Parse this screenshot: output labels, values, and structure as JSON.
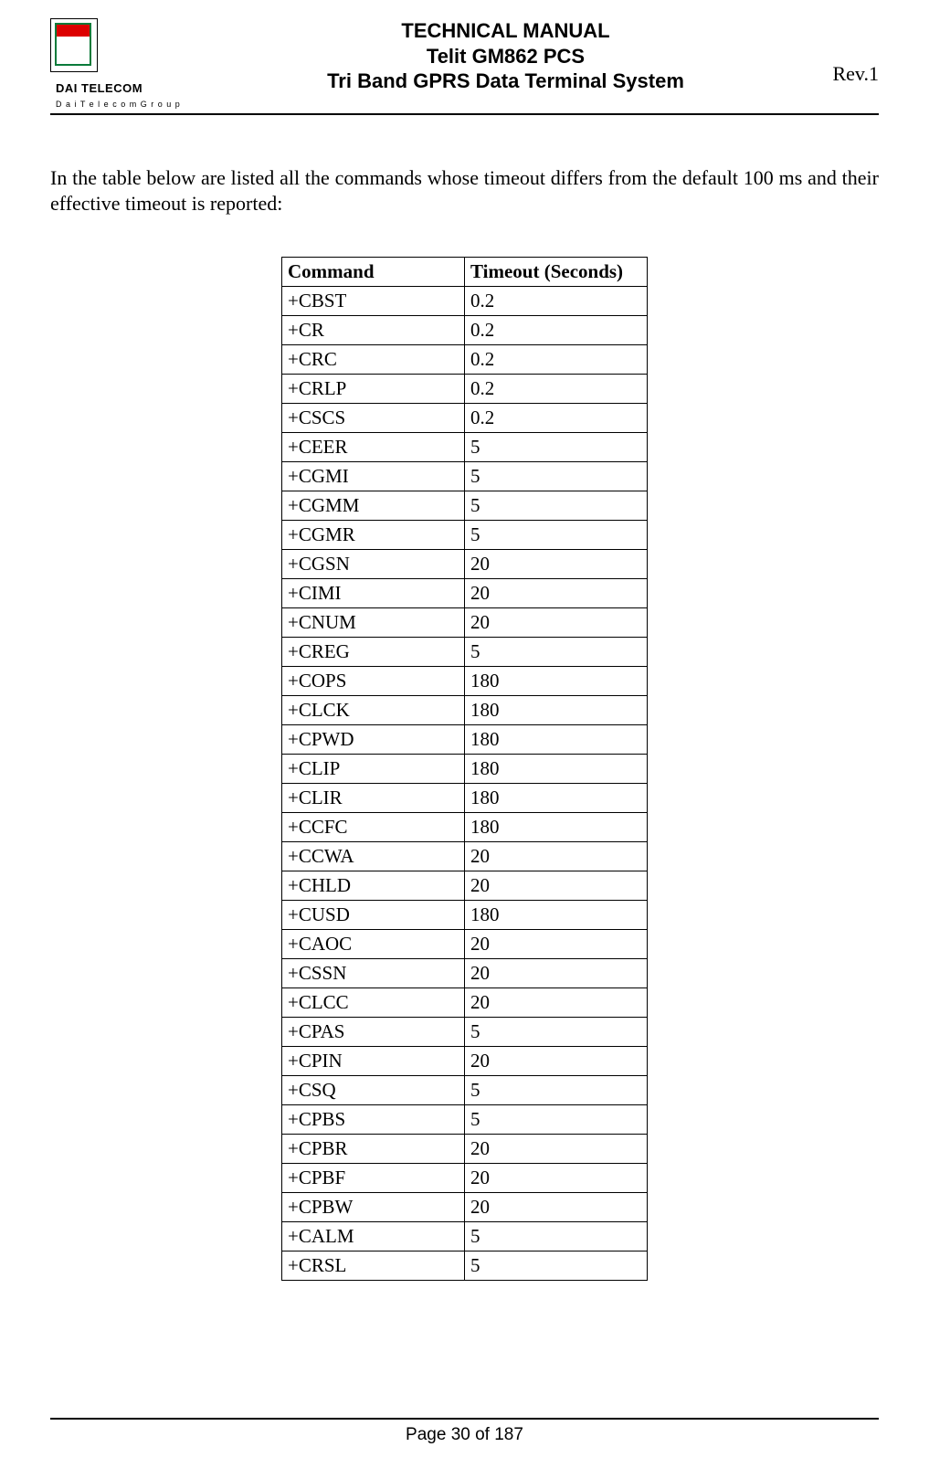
{
  "header": {
    "brand": "DAI TELECOM",
    "brand_sub": "D a i   T e l e c o m   G r o u p",
    "title_line1": "TECHNICAL MANUAL",
    "title_line2": "Telit GM862 PCS",
    "title_line3": "Tri Band GPRS Data Terminal System",
    "rev": "Rev.1"
  },
  "intro": "In the table below are listed all the commands whose timeout differs from the default 100 ms and their effective timeout is reported:",
  "table": {
    "head": {
      "col1": "Command",
      "col2": "Timeout  (Seconds)"
    },
    "rows": [
      {
        "cmd": "+CBST",
        "timeout": "0.2"
      },
      {
        "cmd": "+CR",
        "timeout": "0.2"
      },
      {
        "cmd": "+CRC",
        "timeout": "0.2"
      },
      {
        "cmd": "+CRLP",
        "timeout": "0.2"
      },
      {
        "cmd": "+CSCS",
        "timeout": "0.2"
      },
      {
        "cmd": "+CEER",
        "timeout": "5"
      },
      {
        "cmd": "+CGMI",
        "timeout": "5"
      },
      {
        "cmd": "+CGMM",
        "timeout": "5"
      },
      {
        "cmd": "+CGMR",
        "timeout": "5"
      },
      {
        "cmd": "+CGSN",
        "timeout": "20"
      },
      {
        "cmd": "+CIMI",
        "timeout": "20"
      },
      {
        "cmd": "+CNUM",
        "timeout": "20"
      },
      {
        "cmd": "+CREG",
        "timeout": "5"
      },
      {
        "cmd": "+COPS",
        "timeout": "180"
      },
      {
        "cmd": "+CLCK",
        "timeout": "180"
      },
      {
        "cmd": "+CPWD",
        "timeout": "180"
      },
      {
        "cmd": "+CLIP",
        "timeout": "180"
      },
      {
        "cmd": "+CLIR",
        "timeout": "180"
      },
      {
        "cmd": "+CCFC",
        "timeout": "180"
      },
      {
        "cmd": "+CCWA",
        "timeout": "20"
      },
      {
        "cmd": "+CHLD",
        "timeout": "20"
      },
      {
        "cmd": "+CUSD",
        "timeout": "180"
      },
      {
        "cmd": "+CAOC",
        "timeout": "20"
      },
      {
        "cmd": "+CSSN",
        "timeout": "20"
      },
      {
        "cmd": "+CLCC",
        "timeout": "20"
      },
      {
        "cmd": "+CPAS",
        "timeout": "5"
      },
      {
        "cmd": "+CPIN",
        "timeout": "20"
      },
      {
        "cmd": "+CSQ",
        "timeout": "5"
      },
      {
        "cmd": "+CPBS",
        "timeout": "5"
      },
      {
        "cmd": "+CPBR",
        "timeout": "20"
      },
      {
        "cmd": "+CPBF",
        "timeout": "20"
      },
      {
        "cmd": "+CPBW",
        "timeout": "20"
      },
      {
        "cmd": "+CALM",
        "timeout": "5"
      },
      {
        "cmd": "+CRSL",
        "timeout": "5"
      }
    ]
  },
  "footer": {
    "page": "Page 30 of 187"
  }
}
